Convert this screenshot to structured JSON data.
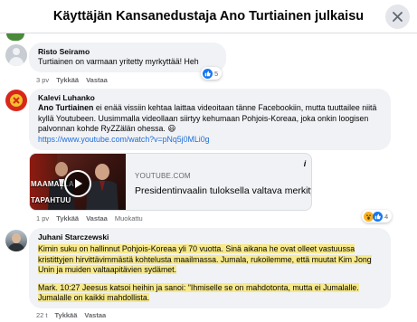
{
  "header": {
    "title": "Käyttäjän Kansanedustaja Ano Turtiainen julkaisu",
    "close_icon": "close-icon"
  },
  "comments": [
    {
      "author": "Risto Seiramo",
      "text": "Turtiainen on varmaan yritetty myrkyttää! Heh",
      "time": "3 pv",
      "like_label": "Tykkää",
      "reply_label": "Vastaa",
      "reaction_count": "5",
      "reaction_icons": [
        "like-emoji-icon"
      ]
    },
    {
      "author": "Kalevi Luhanko",
      "mention": "Ano Turtiainen",
      "text": " ei enää vissiin kehtaa laittaa videoitaan tänne Facebookiin, mutta tuuttailee niitä kyllä Youtubeen. Uusimmalla videollaan siirtyy kehumaan Pohjois-Koreaa, joka onkin loogisen palvonnan kohde RyZZälän ohessa. 😃",
      "link": "https://www.youtube.com/watch?v=pNq5j0MLi0g",
      "time": "1 pv",
      "like_label": "Tykkää",
      "reply_label": "Vastaa",
      "edited_label": "Muokattu",
      "reaction_count": "4",
      "reaction_icons": [
        "wow-emoji-icon",
        "like-emoji-icon"
      ],
      "link_card": {
        "thumb_text_1": "MAAMALLA",
        "thumb_text_2": "TAPAHTUU",
        "domain": "YOUTUBE.COM",
        "title": "Presidentinvaalin tuloksella valtava merkitys.."
      }
    },
    {
      "author": "Juhani Starczewski",
      "paragraph_1": "Kimin suku on hallinnut Pohjois-Koreaa yli 70 vuotta. Sinä aikana he ovat olleet vastuussa kristittyjen hirvittävimmästä kohtelusta maailmassa. Jumala, rukoilemme, että muutat Kim Jong Unin ja muiden valtaapitävien sydämet.",
      "paragraph_2": "Mark. 10:27 Jeesus katsoi heihin ja sanoi: \"Ihmiselle se on mahdotonta, mutta ei Jumalalle. Jumalalle on kaikki mahdollista.",
      "time": "22 t",
      "like_label": "Tykkää",
      "reply_label": "Vastaa"
    }
  ],
  "colors": {
    "link": "#216fdb",
    "bubble": "#f0f2f5",
    "highlight": "#f7e98c",
    "like": "#1877f2"
  }
}
